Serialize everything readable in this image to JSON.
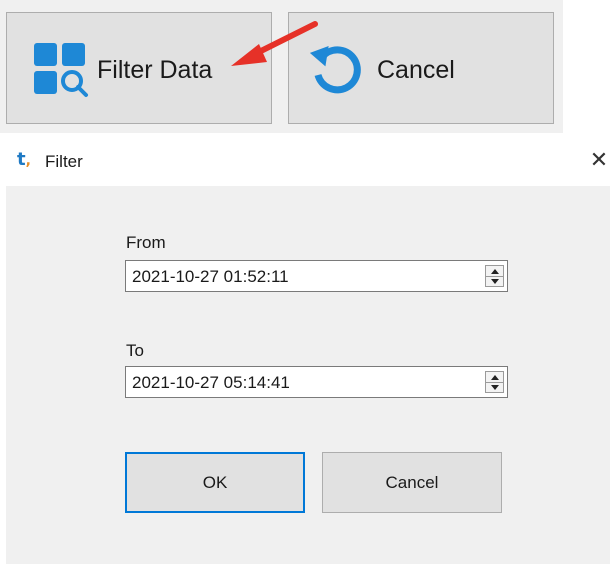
{
  "toolbar": {
    "filter_label": "Filter Data",
    "cancel_label": "Cancel",
    "filter_icon": "filter-grid-search-icon",
    "cancel_icon": "undo-arrow-icon",
    "annotation": "red-arrow-pointer",
    "colors": {
      "icon_blue": "#1e88d6",
      "arrow_red": "#e63128",
      "button_bg": "#e1e1e1"
    }
  },
  "dialog": {
    "app_icon_letter": "t",
    "title": "Filter",
    "close_glyph": "✕",
    "from_label": "From",
    "from_value": "2021-10-27 01:52:11",
    "to_label": "To",
    "to_value": "2021-10-27 05:14:41",
    "ok_label": "OK",
    "cancel_label": "Cancel",
    "colors": {
      "focus_border": "#0078d7",
      "body_bg": "#f0f0f0"
    }
  }
}
